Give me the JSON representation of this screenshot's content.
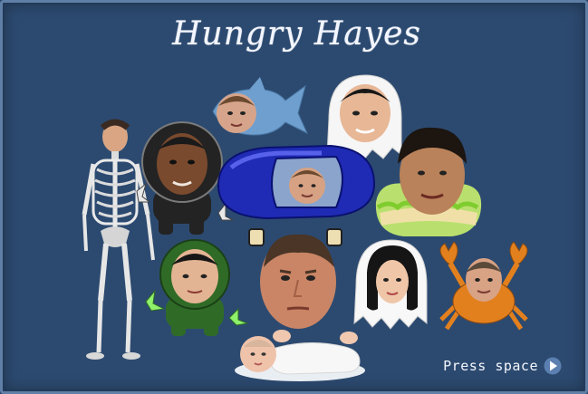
{
  "game": {
    "title": "Hungry Hayes",
    "prompt_label": "Press space",
    "prompt_icon": "play-arrow-icon"
  },
  "colors": {
    "background": "#2c4a70",
    "border": "#5f7fa6",
    "title": "#f3f6ff",
    "car": "#1f2bb5",
    "ghost": "#ffffff",
    "green_alien": "#2f6b27",
    "black_robot": "#232323",
    "crab": "#e3801e",
    "shark": "#6e9fcf"
  },
  "characters": [
    "skeleton-character",
    "black-robot-character",
    "shark-character",
    "ghost-character-top",
    "car-character",
    "sandwich-character",
    "green-alien-character",
    "big-face-character",
    "ghost-character-bottom",
    "crab-character",
    "baby-character"
  ]
}
